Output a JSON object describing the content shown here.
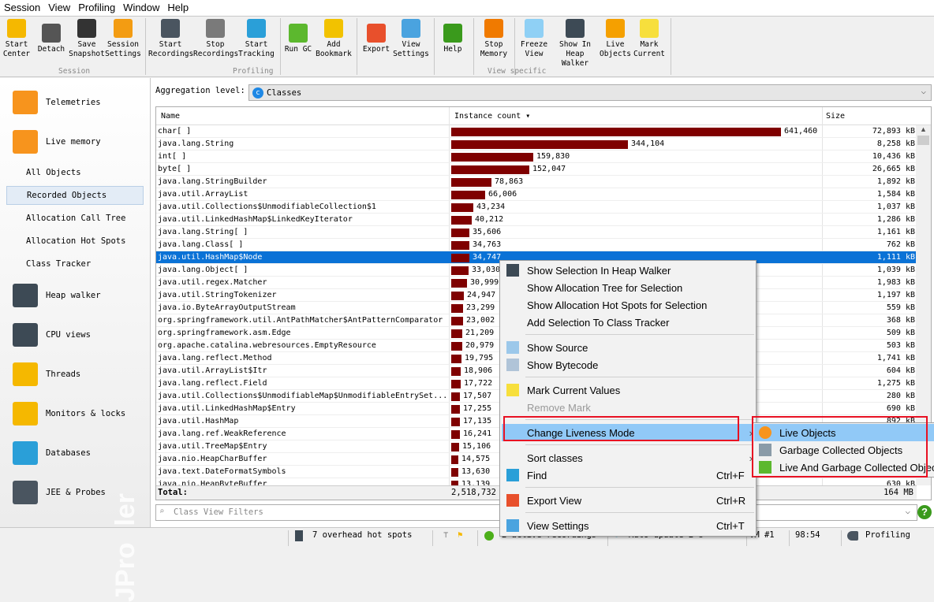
{
  "menubar": [
    "Session",
    "View",
    "Profiling",
    "Window",
    "Help"
  ],
  "toolbar": {
    "buttons": [
      {
        "label1": "Start",
        "label2": "Center",
        "icon": "start-center-icon",
        "color": "#f5b800"
      },
      {
        "label1": "Detach",
        "label2": "",
        "icon": "detach-icon",
        "color": "#555555"
      },
      {
        "label1": "Save",
        "label2": "Snapshot",
        "icon": "save-snapshot-icon",
        "color": "#333333"
      },
      {
        "label1": "Session",
        "label2": "Settings",
        "icon": "session-settings-icon",
        "color": "#f39c12"
      },
      {
        "label1": "Start",
        "label2": "Recordings",
        "icon": "start-recordings-icon",
        "color": "#4a5560"
      },
      {
        "label1": "Stop",
        "label2": "Recordings",
        "icon": "stop-recordings-icon",
        "color": "#7a7a7a"
      },
      {
        "label1": "Start",
        "label2": "Tracking",
        "icon": "start-tracking-icon",
        "color": "#2a9fd8"
      },
      {
        "label1": "Run GC",
        "label2": "",
        "icon": "run-gc-icon",
        "color": "#5cb82e"
      },
      {
        "label1": "Add",
        "label2": "Bookmark",
        "icon": "add-bookmark-icon",
        "color": "#f2c200"
      },
      {
        "label1": "Export",
        "label2": "",
        "icon": "export-icon",
        "color": "#e8502c"
      },
      {
        "label1": "View",
        "label2": "Settings",
        "icon": "view-settings-icon",
        "color": "#4aa3df"
      },
      {
        "label1": "Help",
        "label2": "",
        "icon": "help-icon",
        "color": "#3a9a1c"
      },
      {
        "label1": "Stop",
        "label2": "Memory",
        "icon": "stop-memory-icon",
        "color": "#f07a00"
      },
      {
        "label1": "Freeze",
        "label2": "View",
        "icon": "freeze-view-icon",
        "color": "#8fd0f5"
      },
      {
        "label1": "Show In",
        "label2": "Heap Walker",
        "icon": "heap-walker-camera-icon",
        "color": "#3d4a55"
      },
      {
        "label1": "Live",
        "label2": "Objects",
        "icon": "live-objects-icon",
        "color": "#f5a000"
      },
      {
        "label1": "Mark",
        "label2": "Current",
        "icon": "mark-current-icon",
        "color": "#f7df3c"
      }
    ],
    "groups": [
      "Session",
      "Profiling",
      "View specific"
    ]
  },
  "sidebar": {
    "items": [
      {
        "label": "Telemetries",
        "icon": "telemetries-icon",
        "color": "#f7941d"
      },
      {
        "label": "Live memory",
        "icon": "live-memory-icon",
        "color": "#f7941d"
      },
      {
        "label": "Heap walker",
        "icon": "heap-walker-icon",
        "color": "#3d4a55"
      },
      {
        "label": "CPU views",
        "icon": "cpu-views-icon",
        "color": "#3d4a55"
      },
      {
        "label": "Threads",
        "icon": "threads-icon",
        "color": "#f5b800"
      },
      {
        "label": "Monitors & locks",
        "icon": "monitors-locks-icon",
        "color": "#f5b800"
      },
      {
        "label": "Databases",
        "icon": "databases-icon",
        "color": "#2a9fd8"
      },
      {
        "label": "JEE & Probes",
        "icon": "jee-probes-icon",
        "color": "#4a5560"
      }
    ],
    "subitems": [
      "All Objects",
      "Recorded Objects",
      "Allocation Call Tree",
      "Allocation Hot Spots",
      "Class Tracker"
    ],
    "selected_subitem": "Recorded Objects",
    "watermark": "JProfiler"
  },
  "main": {
    "aggregation_label": "Aggregation level:",
    "aggregation_value": "Classes",
    "columns": {
      "name": "Name",
      "count": "Instance count ▾",
      "size": "Size"
    },
    "bar_color": "#7f0000",
    "rows": [
      {
        "name": "char[ ]",
        "count": "641,460",
        "v": 641460,
        "size": "72,893 kB"
      },
      {
        "name": "java.lang.String",
        "count": "344,104",
        "v": 344104,
        "size": "8,258 kB"
      },
      {
        "name": "int[ ]",
        "count": "159,830",
        "v": 159830,
        "size": "10,436 kB"
      },
      {
        "name": "byte[ ]",
        "count": "152,047",
        "v": 152047,
        "size": "26,665 kB"
      },
      {
        "name": "java.lang.StringBuilder",
        "count": "78,863",
        "v": 78863,
        "size": "1,892 kB"
      },
      {
        "name": "java.util.ArrayList",
        "count": "66,006",
        "v": 66006,
        "size": "1,584 kB"
      },
      {
        "name": "java.util.Collections$UnmodifiableCollection$1",
        "count": "43,234",
        "v": 43234,
        "size": "1,037 kB"
      },
      {
        "name": "java.util.LinkedHashMap$LinkedKeyIterator",
        "count": "40,212",
        "v": 40212,
        "size": "1,286 kB"
      },
      {
        "name": "java.lang.String[ ]",
        "count": "35,606",
        "v": 35606,
        "size": "1,161 kB"
      },
      {
        "name": "java.lang.Class[ ]",
        "count": "34,763",
        "v": 34763,
        "size": "762 kB"
      },
      {
        "name": "java.util.HashMap$Node",
        "count": "34,747",
        "v": 34747,
        "size": "1,111 kB",
        "selected": true
      },
      {
        "name": "java.lang.Object[ ]",
        "count": "33,030",
        "v": 33030,
        "size": "1,039 kB"
      },
      {
        "name": "java.util.regex.Matcher",
        "count": "30,999",
        "v": 30999,
        "size": "1,983 kB"
      },
      {
        "name": "java.util.StringTokenizer",
        "count": "24,947",
        "v": 24947,
        "size": "1,197 kB"
      },
      {
        "name": "java.io.ByteArrayOutputStream",
        "count": "23,299",
        "v": 23299,
        "size": "559 kB"
      },
      {
        "name": "org.springframework.util.AntPathMatcher$AntPatternComparator",
        "count": "23,002",
        "v": 23002,
        "size": "368 kB"
      },
      {
        "name": "org.springframework.asm.Edge",
        "count": "21,209",
        "v": 21209,
        "size": "509 kB"
      },
      {
        "name": "org.apache.catalina.webresources.EmptyResource",
        "count": "20,979",
        "v": 20979,
        "size": "503 kB"
      },
      {
        "name": "java.lang.reflect.Method",
        "count": "19,795",
        "v": 19795,
        "size": "1,741 kB"
      },
      {
        "name": "java.util.ArrayList$Itr",
        "count": "18,906",
        "v": 18906,
        "size": "604 kB"
      },
      {
        "name": "java.lang.reflect.Field",
        "count": "17,722",
        "v": 17722,
        "size": "1,275 kB"
      },
      {
        "name": "java.util.Collections$UnmodifiableMap$UnmodifiableEntrySet...",
        "count": "17,507",
        "v": 17507,
        "size": "280 kB"
      },
      {
        "name": "java.util.LinkedHashMap$Entry",
        "count": "17,255",
        "v": 17255,
        "size": "690 kB"
      },
      {
        "name": "java.util.HashMap",
        "count": "17,135",
        "v": 17135,
        "size": "892 kB"
      },
      {
        "name": "java.lang.ref.WeakReference",
        "count": "16,241",
        "v": 16241,
        "size": ""
      },
      {
        "name": "java.util.TreeMap$Entry",
        "count": "15,106",
        "v": 15106,
        "size": ""
      },
      {
        "name": "java.nio.HeapCharBuffer",
        "count": "14,575",
        "v": 14575,
        "size": ""
      },
      {
        "name": "java.text.DateFormatSymbols",
        "count": "13,630",
        "v": 13630,
        "size": ""
      },
      {
        "name": "java.nio.HeapByteBuffer",
        "count": "13,139",
        "v": 13139,
        "size": "630 kB"
      }
    ],
    "total_label": "Total:",
    "total_count": "2,518,732",
    "total_size": "164 MB",
    "filter_placeholder": "Class View Filters"
  },
  "status": {
    "hotspots": "7 overhead hot spots",
    "recordings": "2 active recordings",
    "auto_update": "Auto update 2 s",
    "vm": "VM #1",
    "time": "98:54",
    "mode": "Profiling"
  },
  "context_menu": {
    "items": [
      {
        "label": "Show Selection In Heap Walker",
        "icon": "camera-icon"
      },
      {
        "label": "Show Allocation Tree for Selection"
      },
      {
        "label": "Show Allocation Hot Spots for Selection"
      },
      {
        "label": "Add Selection To Class Tracker"
      },
      {
        "label": "Show Source",
        "icon": "source-icon"
      },
      {
        "label": "Show Bytecode",
        "icon": "bytecode-icon"
      },
      {
        "label": "Mark Current Values",
        "icon": "sticky-note-icon"
      },
      {
        "label": "Remove Mark",
        "disabled": true
      },
      {
        "label": "Change Liveness Mode",
        "submenu": true,
        "highlighted": true
      },
      {
        "label": "Sort classes",
        "submenu": true
      },
      {
        "label": "Find",
        "shortcut": "Ctrl+F",
        "icon": "find-icon"
      },
      {
        "label": "Export View",
        "shortcut": "Ctrl+R",
        "icon": "export-icon"
      },
      {
        "label": "View Settings",
        "shortcut": "Ctrl+T",
        "icon": "view-settings-icon"
      }
    ],
    "submenu": [
      {
        "label": "Live Objects",
        "icon": "live-objects-icon",
        "highlighted": true
      },
      {
        "label": "Garbage Collected Objects",
        "icon": "trash-icon"
      },
      {
        "label": "Live And Garbage Collected Objects",
        "icon": "trash-live-icon"
      }
    ]
  },
  "annotation_color": "#e81123"
}
